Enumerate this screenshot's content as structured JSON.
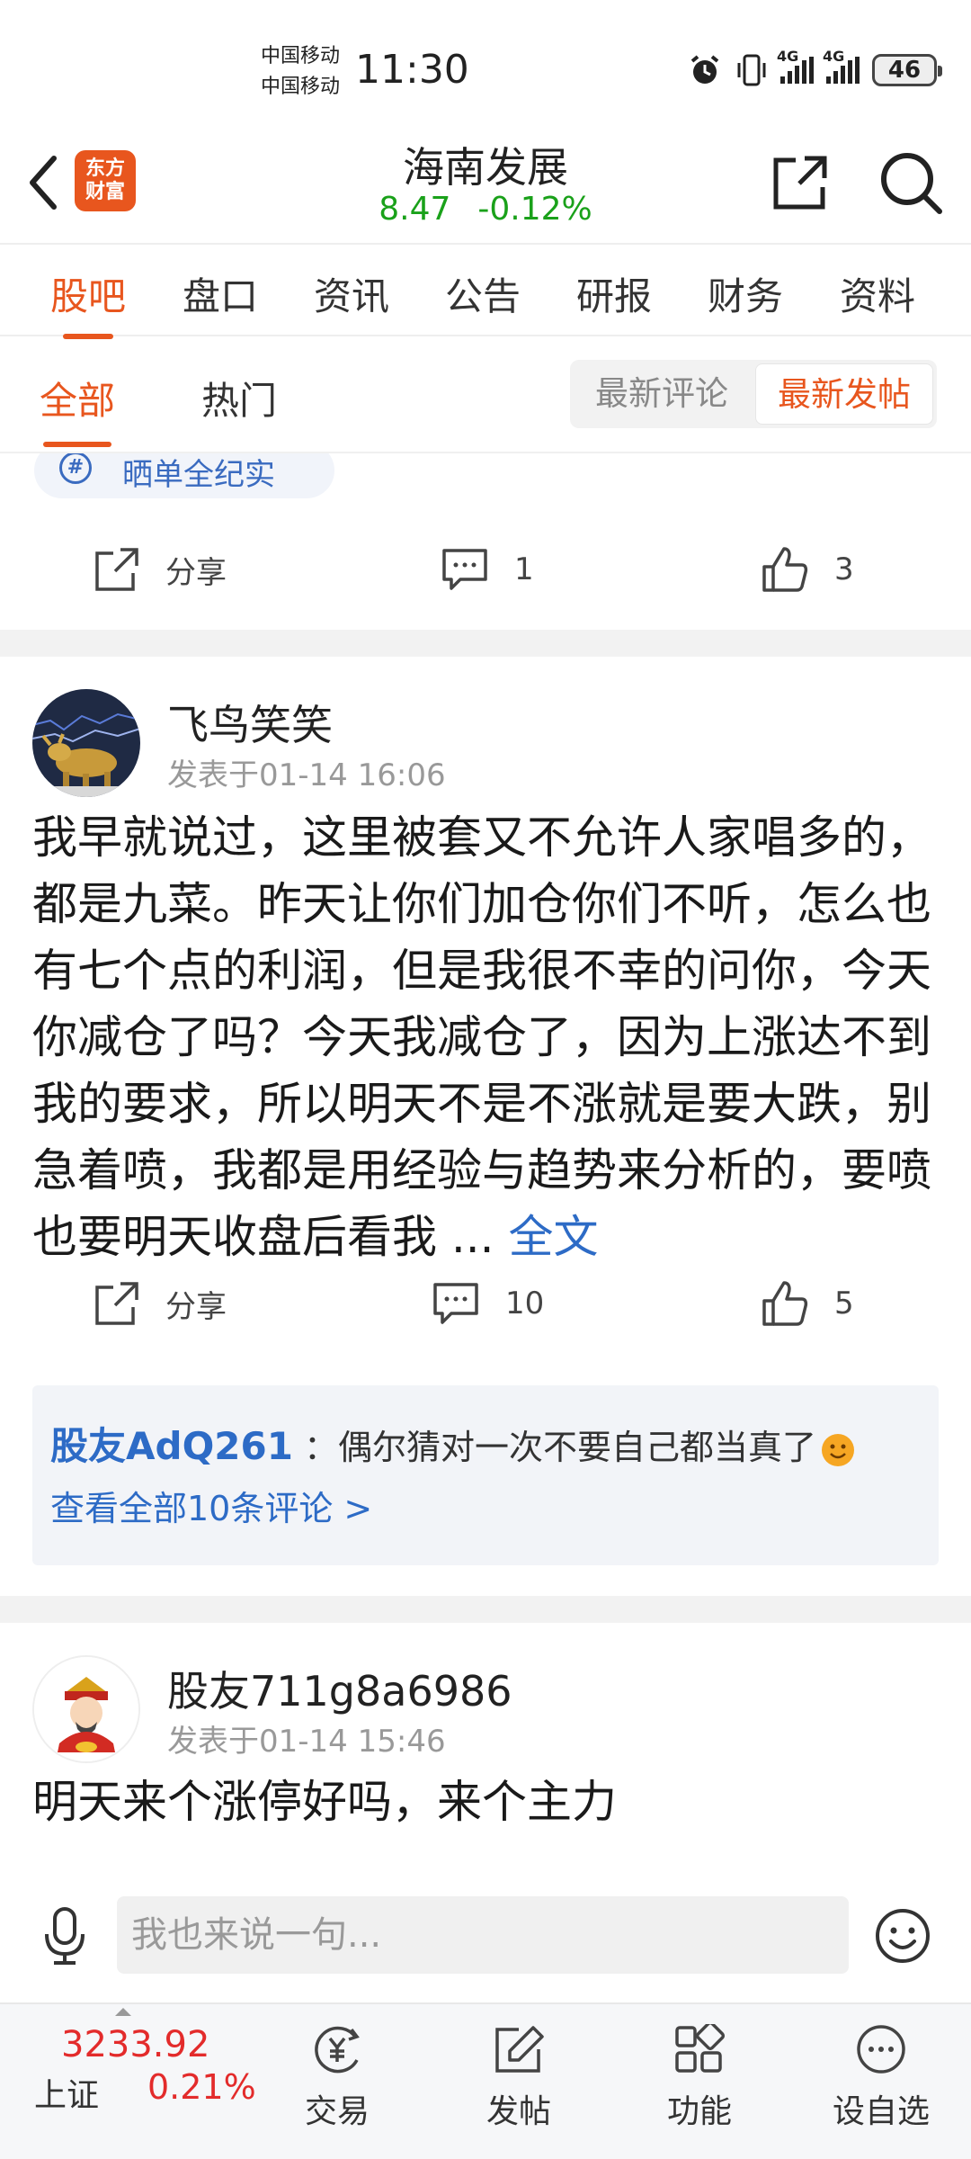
{
  "status_bar": {
    "carrier_1": "中国移动",
    "carrier_2": "中国移动",
    "time": "11:30",
    "network_1": "4G",
    "network_2": "4G",
    "battery": "46"
  },
  "header": {
    "logo_line1": "东方",
    "logo_line2": "财富",
    "stock_name": "海南发展",
    "price": "8.47",
    "change": "-0.12%",
    "price_color": "#1aa11a"
  },
  "tabs": [
    "股吧",
    "盘口",
    "资讯",
    "公告",
    "研报",
    "财务",
    "资料"
  ],
  "subtabs": {
    "all": "全部",
    "hot": "热门",
    "sort_latest_comment": "最新评论",
    "sort_latest_post": "最新发帖"
  },
  "prev_post": {
    "topic": "晒单全纪实",
    "share_label": "分享",
    "comments": "1",
    "likes": "3"
  },
  "post1": {
    "username": "飞鸟笑笑",
    "time": "发表于01-14 16:06",
    "content": "我早就说过，这里被套又不允许人家唱多的，都是九菜。昨天让你们加仓你们不听，怎么也有七个点的利润，但是我很不幸的问你，今天你减仓了吗？今天我减仓了，因为上涨达不到我的要求，所以明天不是不涨就是要大跌，别急着喷，我都是用经验与趋势来分析的，要喷也要明天收盘后看我 ...",
    "more": "全文",
    "share_label": "分享",
    "comments": "10",
    "likes": "5",
    "top_comment_user": "股友AdQ261",
    "top_comment_text": "：偶尔猜对一次不要自己都当真了",
    "view_all": "查看全部10条评论 >"
  },
  "post2": {
    "username": "股友711g8a6986",
    "time": "发表于01-14 15:46",
    "content": "明天来个涨停好吗，来个主力"
  },
  "reply_bar": {
    "placeholder": "我也来说一句..."
  },
  "bottom_bar": {
    "index_value": "3233.92",
    "index_name": "上证",
    "index_change": "0.21%",
    "nav": [
      "交易",
      "发帖",
      "功能",
      "设自选"
    ]
  },
  "colors": {
    "accent": "#e8561e",
    "link": "#2d6bc6",
    "up": "#e32b2b",
    "down": "#1aa11a"
  }
}
